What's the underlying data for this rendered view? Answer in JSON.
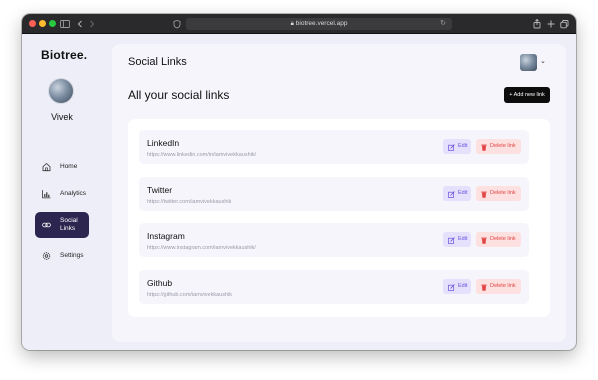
{
  "browser": {
    "url": "biotree.vercel.app",
    "icons": [
      "back-icon",
      "forward-icon",
      "sidebar-toggle-icon",
      "shield-icon",
      "lock-icon",
      "reload-icon",
      "share-icon",
      "new-tab-icon",
      "tabs-icon"
    ]
  },
  "sidebar": {
    "brand": "Biotree.",
    "username": "Vivek",
    "items": [
      {
        "label": "Home",
        "icon": "home-icon",
        "active": false
      },
      {
        "label": "Analytics",
        "icon": "chart-icon",
        "active": false
      },
      {
        "label_line1": "Social",
        "label_line2": "Links",
        "icon": "link-icon",
        "active": true
      },
      {
        "label": "Settings",
        "icon": "gear-icon",
        "active": false
      }
    ]
  },
  "header": {
    "title": "Social Links"
  },
  "main": {
    "heading": "All your social links",
    "add_button": "+ Add new link",
    "edit_label": "Edit",
    "delete_label": "Delete link",
    "links": [
      {
        "name": "LinkedIn",
        "url": "https://www.linkedin.com/in/iamvivekkaushik/"
      },
      {
        "name": "Twitter",
        "url": "https://twitter.com/iamvivekkaushik"
      },
      {
        "name": "Instagram",
        "url": "https://www.instagram.com/iamvivekkaushik/"
      },
      {
        "name": "Github",
        "url": "https://github.com/iamvivekkaushik"
      }
    ]
  },
  "colors": {
    "accent": "#2c2550",
    "edit_bg": "#e5e0fb",
    "edit_text": "#6a4fe0",
    "delete_bg": "#fde1e1",
    "delete_text": "#e24545"
  }
}
